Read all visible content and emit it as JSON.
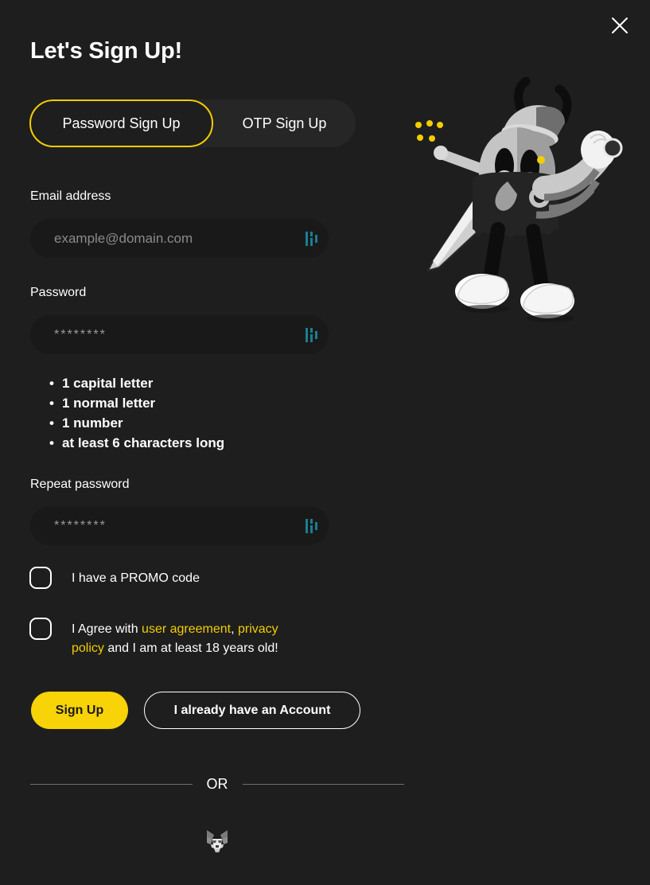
{
  "window": {
    "background_color": "#1e1e1e",
    "accent_color": "#f2cd00"
  },
  "header": {
    "title": "Let's Sign Up!",
    "close_icon": "close-icon"
  },
  "tabs": [
    {
      "label": "Password Sign Up",
      "active": true
    },
    {
      "label": "OTP Sign Up",
      "active": false
    }
  ],
  "form": {
    "email": {
      "label": "Email address",
      "placeholder": "example@domain.com",
      "value": "",
      "icon": "password-manager-icon"
    },
    "password": {
      "label": "Password",
      "placeholder": "",
      "value": "********",
      "icon": "password-manager-icon"
    },
    "repeat_password": {
      "label": "Repeat password",
      "placeholder": "",
      "value": "********",
      "icon": "password-manager-icon"
    },
    "password_rules": [
      "1 capital letter",
      "1 normal letter",
      "1 number",
      "at least 6 characters long"
    ]
  },
  "checkboxes": {
    "promo": {
      "label": "I have a PROMO code",
      "checked": false
    },
    "agreement": {
      "prefix": "I Agree with ",
      "link_user_agreement": "user agreement",
      "separator": ", ",
      "link_privacy_policy": "privacy policy",
      "suffix": " and I am at least 18 years old!",
      "checked": false
    }
  },
  "buttons": {
    "sign_up": "Sign Up",
    "existing_account": "I already have an Account"
  },
  "divider": {
    "text": "OR"
  },
  "wallets": [
    {
      "name": "metamask-icon",
      "label": "MetaMask"
    }
  ],
  "illustration": {
    "name": "mascot-character"
  }
}
